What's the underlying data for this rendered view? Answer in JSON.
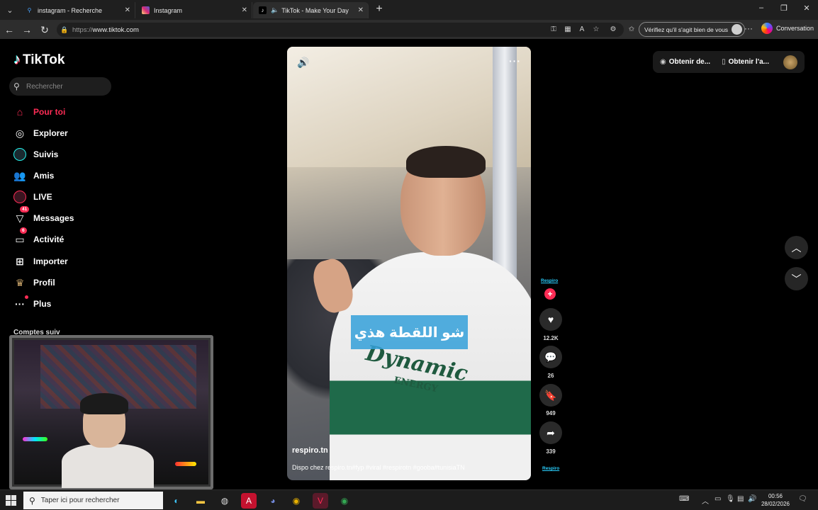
{
  "browser": {
    "tabs": [
      {
        "title": "instagram - Recherche",
        "icon": "search-icon"
      },
      {
        "title": "Instagram",
        "icon": "instagram-icon"
      },
      {
        "title": "TikTok - Make Your Day",
        "icon": "tiktok-icon",
        "active": true
      }
    ],
    "url_protocol": "https://",
    "url_domain": "www.tiktok.com",
    "verify_text": "Vérifiez qu'il s'agit bien de vous",
    "copilot_label": "Conversation"
  },
  "tiktok": {
    "logo_text": "TikTok",
    "search_placeholder": "Rechercher",
    "nav": [
      {
        "label": "Pour toi",
        "icon": "home-icon",
        "active": true
      },
      {
        "label": "Explorer",
        "icon": "compass-icon"
      },
      {
        "label": "Suivis",
        "icon": "following-icon"
      },
      {
        "label": "Amis",
        "icon": "friends-icon"
      },
      {
        "label": "LIVE",
        "icon": "live-icon"
      },
      {
        "label": "Messages",
        "icon": "messages-icon",
        "badge": "41"
      },
      {
        "label": "Activité",
        "icon": "activity-icon",
        "badge": "6"
      },
      {
        "label": "Importer",
        "icon": "upload-icon"
      },
      {
        "label": "Profil",
        "icon": "profile-icon"
      },
      {
        "label": "Plus",
        "icon": "more-icon"
      }
    ],
    "following_title": "Comptes suiv",
    "top_actions": {
      "coins": "Obtenir de...",
      "app": "Obtenir l'a..."
    },
    "video": {
      "caption_overlay": "شو اللقطة هذي",
      "author": "respiro.tn",
      "description": "Dispo chez respiro.tn#fyp #viral #respirotn #gooba#tunisiaTN",
      "brand_text": "Dynamic",
      "brand_sub": "ENERGY"
    },
    "rail": {
      "label_top": "Respiro",
      "label_bottom": "Respiro",
      "likes": "12.2K",
      "comments": "26",
      "saves": "949",
      "shares": "339"
    }
  },
  "taskbar": {
    "search_placeholder": "Taper ici pour rechercher",
    "time": "00:56",
    "date": "28/02/2026"
  },
  "colors": {
    "accent": "#fe2c55",
    "link": "#2ad0ff",
    "caption_bg": "#34a0d9"
  }
}
